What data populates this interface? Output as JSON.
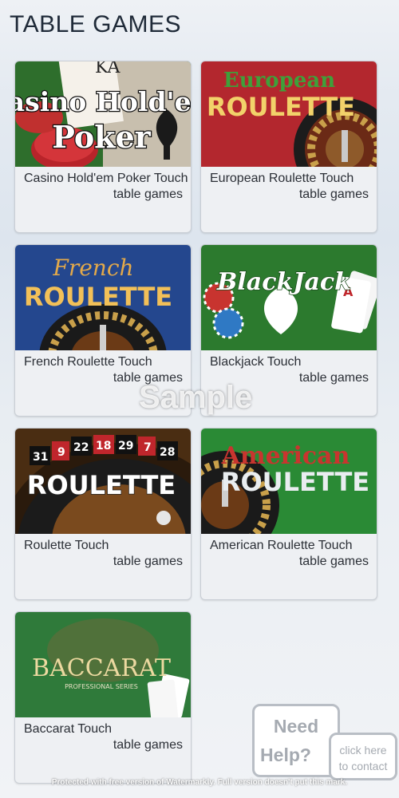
{
  "page": {
    "title": "TABLE GAMES"
  },
  "games": [
    {
      "title": "Casino Hold'em Poker Touch",
      "category": "table games",
      "thumb_text": [
        "Casino Hold'em",
        "Poker"
      ],
      "thumb_color": "#2e6e2c"
    },
    {
      "title": "European Roulette Touch",
      "category": "table games",
      "thumb_text": [
        "European",
        "ROULETTE"
      ],
      "thumb_color": "#b3272e"
    },
    {
      "title": "French Roulette Touch",
      "category": "table games",
      "thumb_text": [
        "French",
        "ROULETTE"
      ],
      "thumb_color": "#24478e"
    },
    {
      "title": "Blackjack Touch",
      "category": "table games",
      "thumb_text": [
        "BlackJack"
      ],
      "thumb_color": "#2c7a2e"
    },
    {
      "title": "Roulette Touch",
      "category": "table games",
      "thumb_text": [
        "ROULETTE",
        "31",
        "9",
        "22",
        "18",
        "29",
        "7",
        "28"
      ],
      "thumb_color": "#4a2d12"
    },
    {
      "title": "American Roulette Touch",
      "category": "table games",
      "thumb_text": [
        "American",
        "ROULETTE"
      ],
      "thumb_color": "#2a8a35"
    },
    {
      "title": "Baccarat Touch",
      "category": "table games",
      "thumb_text": [
        "BACCARAT",
        "PROFESSIONAL SERIES"
      ],
      "thumb_color": "#2f7a3a"
    }
  ],
  "watermark": {
    "text": "Sample"
  },
  "help": {
    "line1": "Need",
    "line2": "Help?"
  },
  "contact": {
    "line1": "click here",
    "line2": "to contact"
  },
  "footer": {
    "note": "Protected with free version of Watermarkly. Full version doesn't put this mark."
  }
}
